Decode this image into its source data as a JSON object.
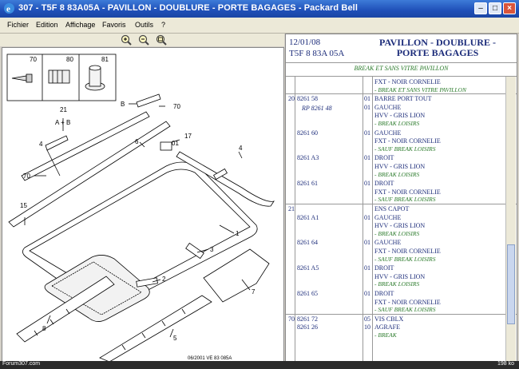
{
  "window": {
    "title": "307 - T5F 8 83A05A - PAVILLON - DOUBLURE - PORTE BAGAGES - Packard Bell"
  },
  "menu": [
    "Fichier",
    "Edition",
    "Affichage",
    "Favoris",
    "Outils",
    "?"
  ],
  "toolbar": {
    "icons": [
      "zoom-in-icon",
      "zoom-out-icon",
      "zoom-fit-icon"
    ]
  },
  "diagram": {
    "inset_labels": [
      "70",
      "80",
      "81"
    ],
    "callouts": [
      "21",
      "A + B",
      "B",
      "70",
      "4",
      "6",
      "01",
      "17",
      "4",
      "70",
      "15",
      "1",
      "3",
      "2",
      "7",
      "8",
      "5"
    ],
    "footer": "06/2001  VE 83 085A"
  },
  "header": {
    "date": "12/01/08",
    "code": "T5F 8 83A 05A",
    "title_lines": [
      "PAVILLON - DOUBLURE -",
      "PORTE BAGAGES"
    ],
    "sub": "BREAK ET SANS VITRE PAVILLON"
  },
  "parts": [
    {
      "num": "",
      "ref": "",
      "qty": "",
      "desc": "FXT - NOIR CORNELIE",
      "notes": [
        "- BREAK ET SANS VITRE PAVILLON"
      ]
    },
    {
      "num": "20",
      "ref": "8261 58",
      "qty": "01",
      "desc": "BARRE PORT TOUT",
      "notes": []
    },
    {
      "num": "",
      "ref": "",
      "qty": "01",
      "desc": "GAUCHE",
      "rp": "RP 8261 48",
      "notes": []
    },
    {
      "num": "",
      "ref": "",
      "qty": "",
      "desc": "HVV - GRIS LION",
      "notes": [
        "- BREAK LOISIRS"
      ]
    },
    {
      "num": "",
      "ref": "8261 60",
      "qty": "01",
      "desc": "GAUCHE",
      "notes": []
    },
    {
      "num": "",
      "ref": "",
      "qty": "",
      "desc": "FXT - NOIR CORNELIE",
      "notes": [
        "- SAUF BREAK LOISIRS"
      ]
    },
    {
      "num": "",
      "ref": "8261 A3",
      "qty": "01",
      "desc": "DROIT",
      "notes": []
    },
    {
      "num": "",
      "ref": "",
      "qty": "",
      "desc": "HVV - GRIS LION",
      "notes": [
        "- BREAK LOISIRS"
      ]
    },
    {
      "num": "",
      "ref": "8261 61",
      "qty": "01",
      "desc": "DROIT",
      "notes": []
    },
    {
      "num": "",
      "ref": "",
      "qty": "",
      "desc": "FXT - NOIR CORNELIE",
      "notes": [
        "- SAUF BREAK LOISIRS"
      ]
    },
    {
      "num": "21",
      "ref": "",
      "qty": "",
      "desc": "ENS CAPOT",
      "notes": []
    },
    {
      "num": "",
      "ref": "8261 A1",
      "qty": "01",
      "desc": "GAUCHE",
      "notes": []
    },
    {
      "num": "",
      "ref": "",
      "qty": "",
      "desc": "HVV - GRIS LION",
      "notes": [
        "- BREAK LOISIRS"
      ]
    },
    {
      "num": "",
      "ref": "8261 64",
      "qty": "01",
      "desc": "GAUCHE",
      "notes": []
    },
    {
      "num": "",
      "ref": "",
      "qty": "",
      "desc": "FXT - NOIR CORNELIE",
      "notes": [
        "- SAUF BREAK LOISIRS"
      ]
    },
    {
      "num": "",
      "ref": "8261 A5",
      "qty": "01",
      "desc": "DROIT",
      "notes": []
    },
    {
      "num": "",
      "ref": "",
      "qty": "",
      "desc": "HVV - GRIS LION",
      "notes": [
        "- BREAK LOISIRS"
      ]
    },
    {
      "num": "",
      "ref": "8261 65",
      "qty": "01",
      "desc": "DROIT",
      "notes": []
    },
    {
      "num": "",
      "ref": "",
      "qty": "",
      "desc": "FXT - NOIR CORNELIE",
      "notes": [
        "- SAUF BREAK LOISIRS"
      ]
    },
    {
      "num": "70",
      "ref": "8261 72",
      "qty": "05",
      "desc": "VIS CBLX",
      "notes": []
    },
    {
      "num": "",
      "ref": "8261 26",
      "qty": "10",
      "desc": "AGRAFE",
      "notes": [
        "- BREAK"
      ]
    }
  ],
  "status": {
    "left": "Forum307.com",
    "right": "198 ko"
  },
  "colors": {
    "title_gradient": "#1f4fb8",
    "navy_text": "#1c2c7a",
    "green_note": "#2a7a2a"
  }
}
